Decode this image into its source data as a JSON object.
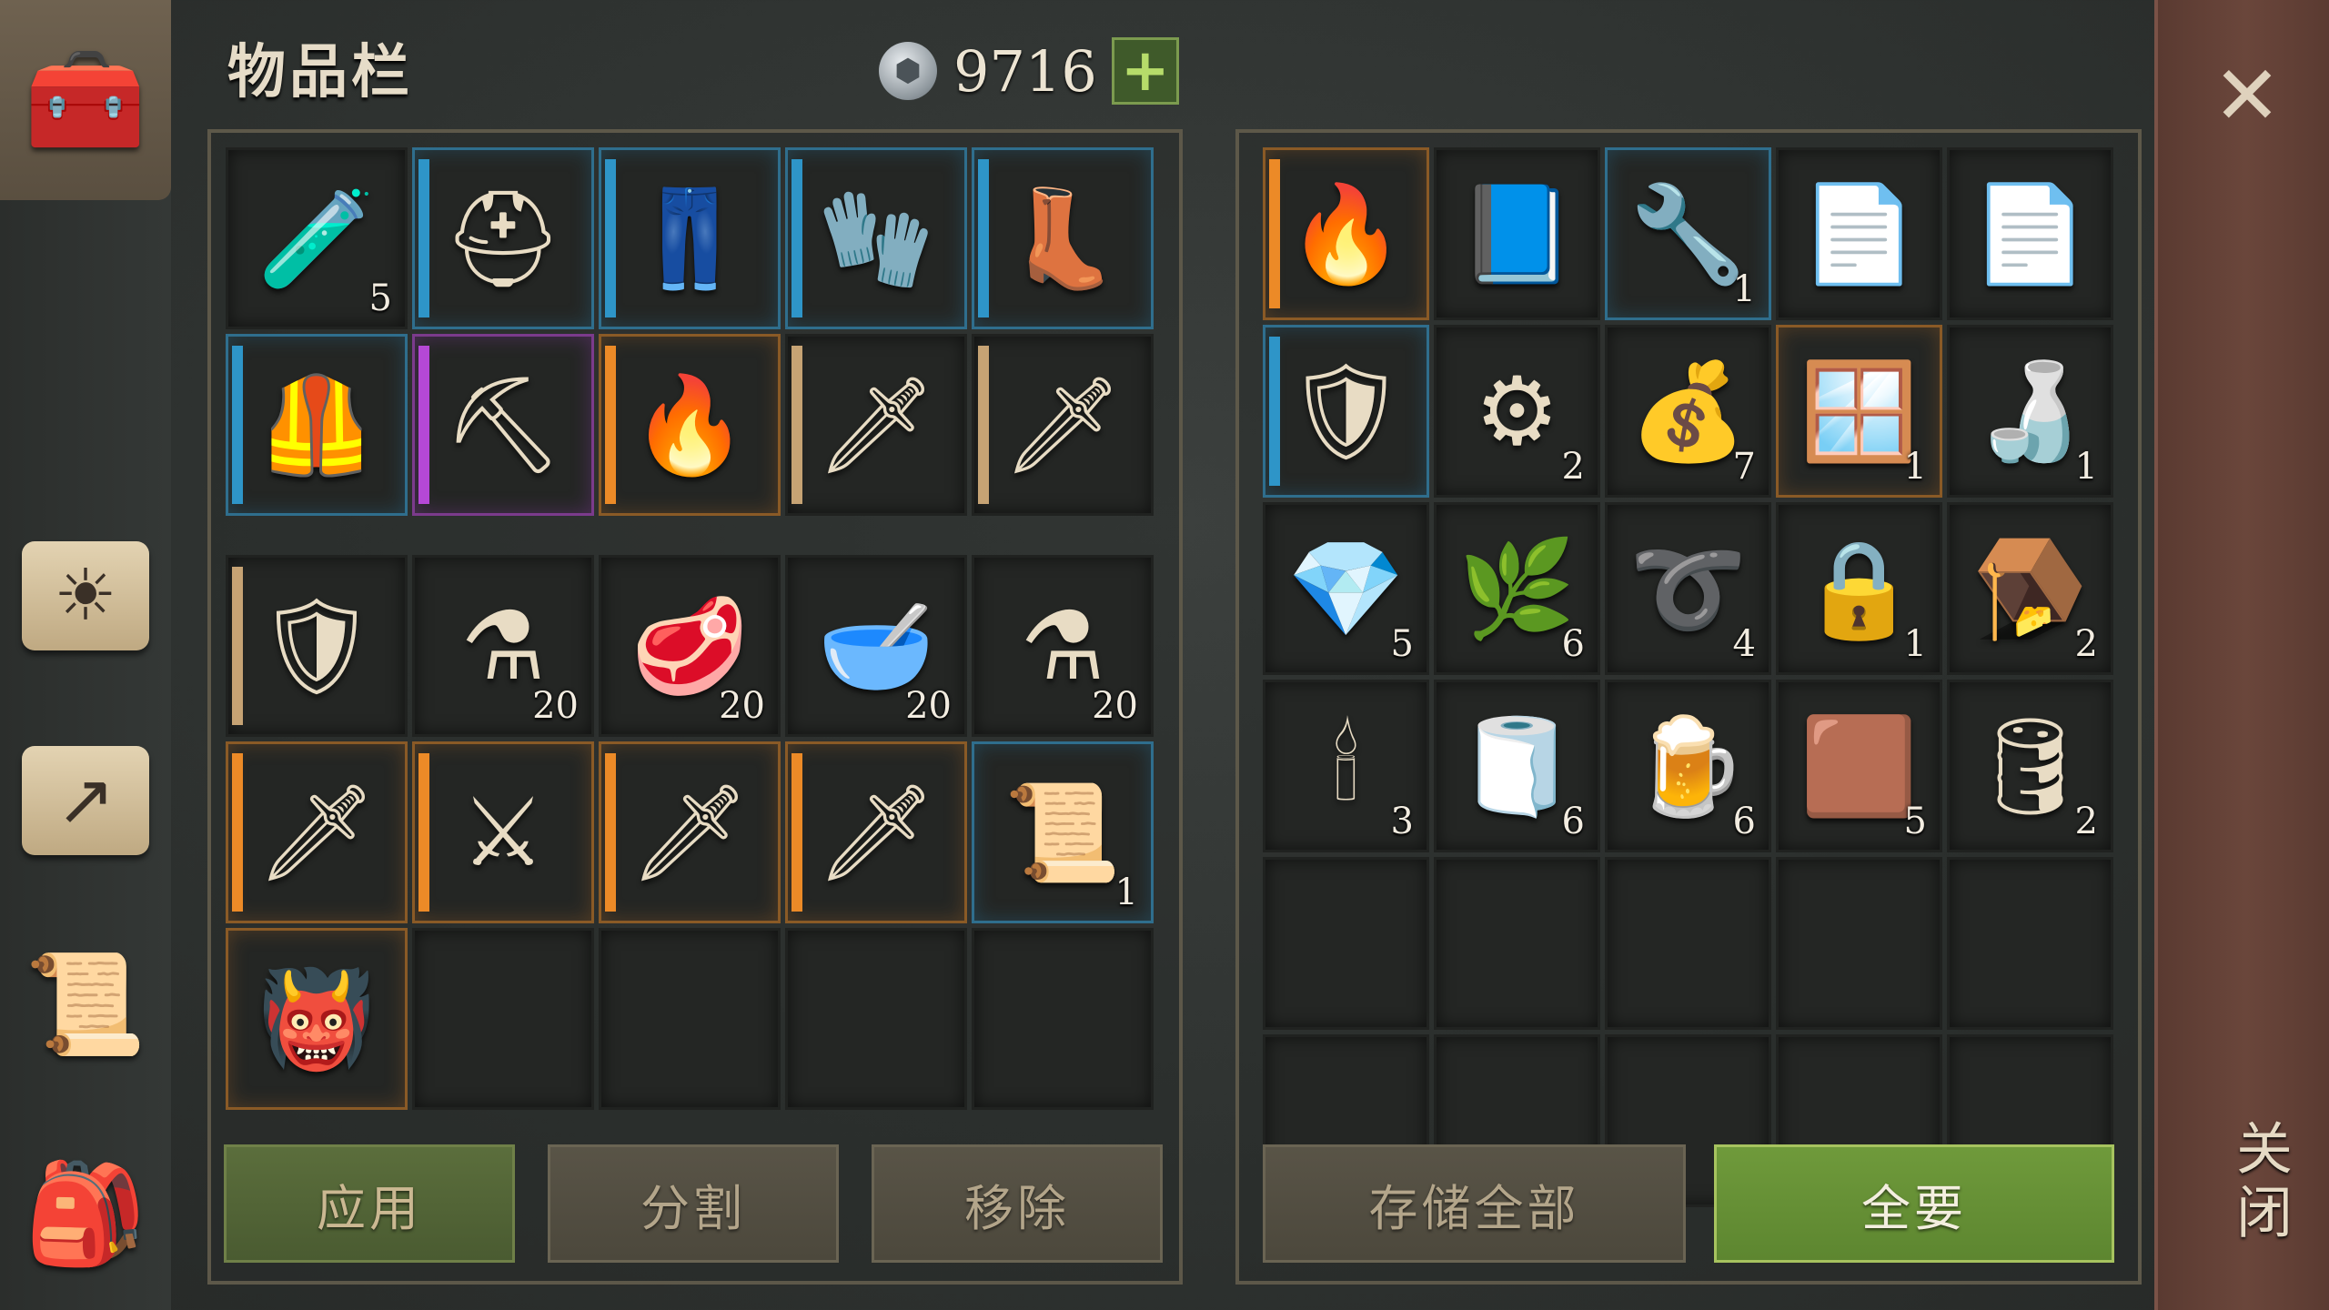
{
  "header": {
    "title": "物品栏",
    "currency_value": "9716",
    "add_currency_icon": "plus-icon"
  },
  "sidebar": {
    "tabs": [
      {
        "name": "inventory-chest-icon",
        "glyph": "🧰"
      },
      {
        "name": "crafting-book-icon",
        "glyph": "☀"
      },
      {
        "name": "map-arrow-icon",
        "glyph": "↗"
      },
      {
        "name": "quest-scroll-icon",
        "glyph": "📜"
      },
      {
        "name": "character-backpack-icon",
        "glyph": "🎒"
      }
    ]
  },
  "equipment": {
    "slots": [
      {
        "item": "purple-potion-amulet",
        "glyph": "🧪",
        "qty": "5",
        "rarity": "",
        "stripe": ""
      },
      {
        "item": "knight-helmet",
        "glyph": "⛑",
        "qty": "",
        "rarity": "rare-blue",
        "stripe": "blue"
      },
      {
        "item": "chain-leggings",
        "glyph": "👖",
        "qty": "",
        "rarity": "rare-blue",
        "stripe": "blue"
      },
      {
        "item": "plate-gloves",
        "glyph": "🧤",
        "qty": "",
        "rarity": "rare-blue",
        "stripe": "blue"
      },
      {
        "item": "leather-boots",
        "glyph": "👢",
        "qty": "",
        "rarity": "rare-blue",
        "stripe": "blue"
      },
      {
        "item": "scale-armor",
        "glyph": "🦺",
        "qty": "",
        "rarity": "rare-blue",
        "stripe": "blue"
      },
      {
        "item": "scythe",
        "glyph": "⛏",
        "qty": "",
        "rarity": "rare-purple",
        "stripe": "purple"
      },
      {
        "item": "flame-sword",
        "glyph": "🔥",
        "qty": "",
        "rarity": "rare-orange",
        "stripe": "orange"
      },
      {
        "item": "katana",
        "glyph": "🗡",
        "qty": "",
        "rarity": "",
        "stripe": "tan"
      },
      {
        "item": "longsword",
        "glyph": "🗡",
        "qty": "",
        "rarity": "",
        "stripe": "tan"
      }
    ]
  },
  "backpack": {
    "slots": [
      {
        "item": "crusader-shield",
        "glyph": "🛡",
        "qty": "",
        "rarity": "",
        "stripe": "tan"
      },
      {
        "item": "light-potion",
        "glyph": "⚗",
        "qty": "20",
        "rarity": "",
        "stripe": ""
      },
      {
        "item": "steak",
        "glyph": "🥩",
        "qty": "20",
        "rarity": "",
        "stripe": ""
      },
      {
        "item": "stew-bowl",
        "glyph": "🥣",
        "qty": "20",
        "rarity": "",
        "stripe": ""
      },
      {
        "item": "purple-potion",
        "glyph": "⚗",
        "qty": "20",
        "rarity": "",
        "stripe": ""
      },
      {
        "item": "bronze-sword",
        "glyph": "🗡",
        "qty": "",
        "rarity": "rare-orange",
        "stripe": "orange"
      },
      {
        "item": "scimitar",
        "glyph": "⚔",
        "qty": "",
        "rarity": "rare-orange",
        "stripe": "orange"
      },
      {
        "item": "steel-sword",
        "glyph": "🗡",
        "qty": "",
        "rarity": "rare-orange",
        "stripe": "orange"
      },
      {
        "item": "ice-sword",
        "glyph": "🗡",
        "qty": "",
        "rarity": "rare-orange",
        "stripe": "orange"
      },
      {
        "item": "rune-scroll",
        "glyph": "📜",
        "qty": "1",
        "rarity": "rare-blue",
        "stripe": ""
      },
      {
        "item": "horned-helmet",
        "glyph": "👹",
        "qty": "",
        "rarity": "rare-orange",
        "stripe": ""
      },
      {
        "item": "",
        "glyph": "",
        "qty": "",
        "rarity": "",
        "stripe": ""
      },
      {
        "item": "",
        "glyph": "",
        "qty": "",
        "rarity": "",
        "stripe": ""
      },
      {
        "item": "",
        "glyph": "",
        "qty": "",
        "rarity": "",
        "stripe": ""
      },
      {
        "item": "",
        "glyph": "",
        "qty": "",
        "rarity": "",
        "stripe": ""
      }
    ]
  },
  "storage": {
    "slots": [
      {
        "item": "flame-sword",
        "glyph": "🔥",
        "qty": "",
        "rarity": "rare-orange",
        "stripe": "orange"
      },
      {
        "item": "spell-book",
        "glyph": "📘",
        "qty": "",
        "rarity": "",
        "stripe": ""
      },
      {
        "item": "iron-clamp",
        "glyph": "🔧",
        "qty": "1",
        "rarity": "rare-blue",
        "stripe": ""
      },
      {
        "item": "blueprint-paper",
        "glyph": "📄",
        "qty": "",
        "rarity": "",
        "stripe": ""
      },
      {
        "item": "blueprint-paper",
        "glyph": "📄",
        "qty": "",
        "rarity": "",
        "stripe": ""
      },
      {
        "item": "round-shield",
        "glyph": "🛡",
        "qty": "",
        "rarity": "rare-blue",
        "stripe": "blue"
      },
      {
        "item": "gear",
        "glyph": "⚙",
        "qty": "2",
        "rarity": "",
        "stripe": ""
      },
      {
        "item": "grain-sack",
        "glyph": "💰",
        "qty": "7",
        "rarity": "",
        "stripe": ""
      },
      {
        "item": "glass-pane",
        "glyph": "🪟",
        "qty": "1",
        "rarity": "rare-orange",
        "stripe": ""
      },
      {
        "item": "leather-flask",
        "glyph": "🍶",
        "qty": "1",
        "rarity": "",
        "stripe": ""
      },
      {
        "item": "energy-crystal",
        "glyph": "💎",
        "qty": "5",
        "rarity": "",
        "stripe": ""
      },
      {
        "item": "herb-ball",
        "glyph": "🌿",
        "qty": "6",
        "rarity": "",
        "stripe": ""
      },
      {
        "item": "rope",
        "glyph": "➰",
        "qty": "4",
        "rarity": "",
        "stripe": ""
      },
      {
        "item": "padlock",
        "glyph": "🔒",
        "qty": "1",
        "rarity": "",
        "stripe": ""
      },
      {
        "item": "bear-trap",
        "glyph": "🪤",
        "qty": "2",
        "rarity": "",
        "stripe": ""
      },
      {
        "item": "candle",
        "glyph": "🕯",
        "qty": "3",
        "rarity": "",
        "stripe": ""
      },
      {
        "item": "cloth",
        "glyph": "🧻",
        "qty": "6",
        "rarity": "",
        "stripe": ""
      },
      {
        "item": "wooden-mug",
        "glyph": "🍺",
        "qty": "6",
        "rarity": "",
        "stripe": ""
      },
      {
        "item": "leather",
        "glyph": "🟫",
        "qty": "5",
        "rarity": "",
        "stripe": ""
      },
      {
        "item": "barrel",
        "glyph": "🛢",
        "qty": "2",
        "rarity": "",
        "stripe": ""
      },
      {
        "item": "",
        "glyph": "",
        "qty": "",
        "rarity": "",
        "stripe": ""
      },
      {
        "item": "",
        "glyph": "",
        "qty": "",
        "rarity": "",
        "stripe": ""
      },
      {
        "item": "",
        "glyph": "",
        "qty": "",
        "rarity": "",
        "stripe": ""
      },
      {
        "item": "",
        "glyph": "",
        "qty": "",
        "rarity": "",
        "stripe": ""
      },
      {
        "item": "",
        "glyph": "",
        "qty": "",
        "rarity": "",
        "stripe": ""
      },
      {
        "item": "",
        "glyph": "",
        "qty": "",
        "rarity": "",
        "stripe": ""
      },
      {
        "item": "",
        "glyph": "",
        "qty": "",
        "rarity": "",
        "stripe": ""
      },
      {
        "item": "",
        "glyph": "",
        "qty": "",
        "rarity": "",
        "stripe": ""
      },
      {
        "item": "",
        "glyph": "",
        "qty": "",
        "rarity": "",
        "stripe": ""
      },
      {
        "item": "",
        "glyph": "",
        "qty": "",
        "rarity": "",
        "stripe": ""
      }
    ]
  },
  "actions": {
    "apply": "应用",
    "split": "分割",
    "remove": "移除",
    "store_all": "存储全部",
    "take_all": "全要"
  },
  "close": {
    "label": "关闭",
    "icon": "close-icon",
    "glyph": "✕"
  },
  "colors": {
    "rare_blue": "#2e95c8",
    "rare_purple": "#b548d6",
    "rare_orange": "#ec8a27",
    "common_tan": "#c6a374",
    "button_green": "#6f9a3b",
    "close_strip": "#6a463b"
  }
}
